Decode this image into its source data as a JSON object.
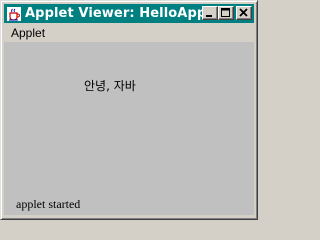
{
  "window": {
    "title": "Applet Viewer: HelloApplet",
    "title_bar_color": "#008080",
    "title_text_color": "#ffffff",
    "icons": {
      "app": "java-cup-icon",
      "minimize": "minimize-icon",
      "maximize": "maximize-icon",
      "close": "close-icon"
    }
  },
  "menubar": {
    "items": [
      {
        "label": "Applet"
      }
    ]
  },
  "applet": {
    "text": "안녕, 자바",
    "background": "#c0c0c0"
  },
  "status": {
    "text": "applet started"
  }
}
